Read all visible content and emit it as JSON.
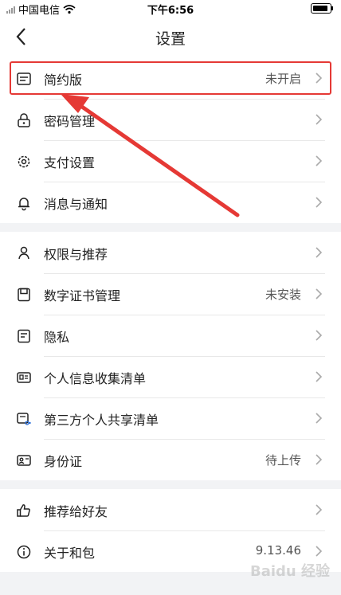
{
  "status_bar": {
    "carrier": "中国电信",
    "time": "下午6:56"
  },
  "nav": {
    "title": "设置"
  },
  "group1": [
    {
      "label": "简约版",
      "value": "未开启",
      "icon": "simple-mode-icon"
    },
    {
      "label": "密码管理",
      "value": "",
      "icon": "lock-icon"
    },
    {
      "label": "支付设置",
      "value": "",
      "icon": "gear-icon"
    },
    {
      "label": "消息与通知",
      "value": "",
      "icon": "bell-icon"
    }
  ],
  "group2": [
    {
      "label": "权限与推荐",
      "value": "",
      "icon": "permission-icon"
    },
    {
      "label": "数字证书管理",
      "value": "未安装",
      "icon": "certificate-icon"
    },
    {
      "label": "隐私",
      "value": "",
      "icon": "privacy-icon"
    },
    {
      "label": "个人信息收集清单",
      "value": "",
      "icon": "id-card-icon"
    },
    {
      "label": "第三方个人共享清单",
      "value": "",
      "icon": "share-list-icon"
    },
    {
      "label": "身份证",
      "value": "待上传",
      "icon": "identity-card-icon"
    }
  ],
  "group3": [
    {
      "label": "推荐给好友",
      "value": "",
      "icon": "thumbs-up-icon"
    },
    {
      "label": "关于和包",
      "value": "9.13.46",
      "icon": "info-icon"
    }
  ],
  "watermark": "Baidu 经验",
  "colors": {
    "highlight": "#e53935",
    "background": "#f2f3f5"
  }
}
